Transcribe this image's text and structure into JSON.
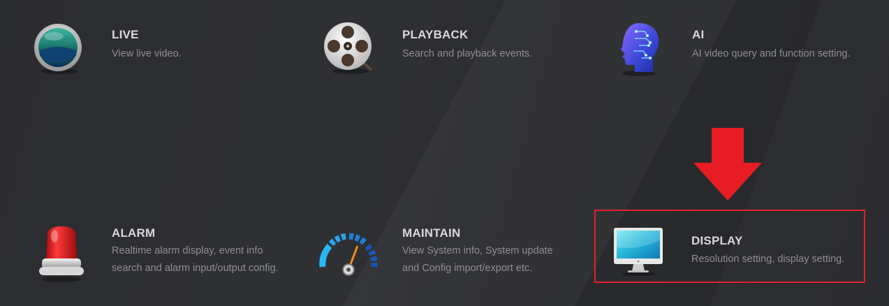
{
  "menu": {
    "live": {
      "title": "LIVE",
      "desc": [
        "View live video."
      ]
    },
    "playback": {
      "title": "PLAYBACK",
      "desc": [
        "Search and playback events."
      ]
    },
    "ai": {
      "title": "AI",
      "desc": [
        "AI video query and function setting."
      ]
    },
    "alarm": {
      "title": "ALARM",
      "desc": [
        "Realtime alarm display, event info",
        "search and alarm input/output config."
      ]
    },
    "maintain": {
      "title": "MAINTAIN",
      "desc": [
        "View System info, System update",
        "and Config import/export etc."
      ]
    },
    "display": {
      "title": "DISPLAY",
      "desc": [
        "Resolution setting, display setting."
      ]
    }
  },
  "annotation": {
    "highlight_color": "#e0212a",
    "arrow_color": "#e81c24"
  },
  "icons": {
    "live": "live-icon",
    "playback": "film-reel-icon",
    "ai": "ai-head-icon",
    "alarm": "alarm-beacon-icon",
    "maintain": "gauge-icon",
    "display": "monitor-icon"
  }
}
